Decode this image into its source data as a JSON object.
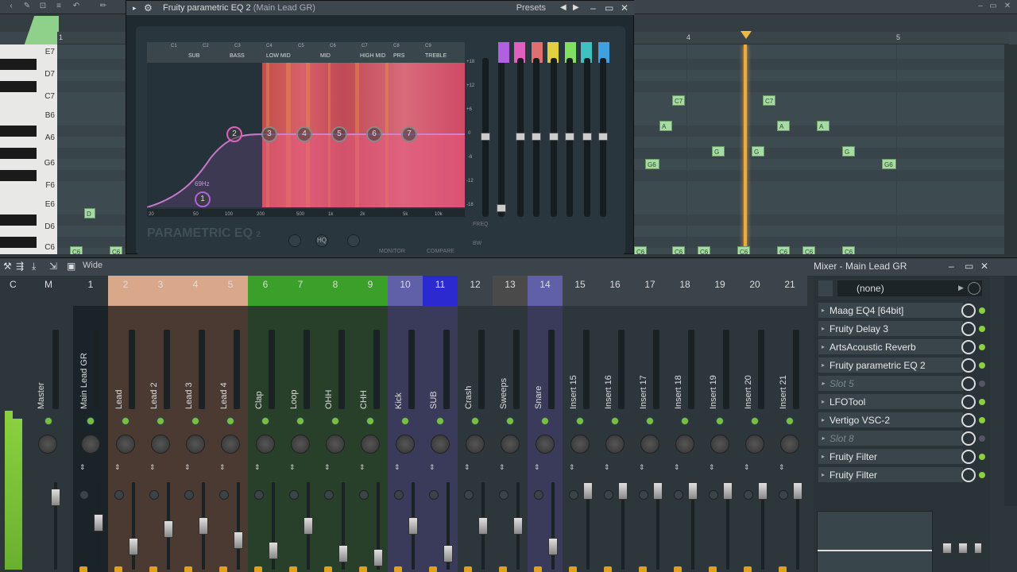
{
  "piano_roll": {
    "ruler": [
      "1",
      "4",
      "5"
    ],
    "keys": [
      "E7",
      "D7",
      "C7",
      "B6",
      "A6",
      "G6",
      "F6",
      "E6",
      "D6",
      "C6"
    ],
    "notes": [
      "D",
      "C7",
      "C7",
      "A",
      "A",
      "A",
      "G",
      "G",
      "G",
      "G6",
      "G6"
    ],
    "bottom_notes": [
      "C6",
      "C6",
      "C6",
      "C6",
      "C6",
      "C6",
      "C6",
      "C6",
      "C6"
    ]
  },
  "eq": {
    "title": "Fruity parametric EQ 2",
    "title_suffix": "(Main Lead GR)",
    "presets_label": "Presets",
    "band_labels": [
      "C1",
      "C2",
      "C3",
      "C4",
      "C5",
      "C6",
      "C7",
      "C8",
      "C9"
    ],
    "band_categories": [
      "SUB",
      "BASS",
      "LOW MID",
      "MID",
      "HIGH MID",
      "PRS",
      "TREBLE"
    ],
    "node_labels": [
      "1",
      "2",
      "3",
      "4",
      "5",
      "6",
      "7"
    ],
    "node1_freq": "69Hz",
    "freq_axis": [
      "20",
      "50",
      "100",
      "200",
      "500",
      "1k",
      "2k",
      "5k",
      "10k"
    ],
    "db_axis": [
      "+18",
      "+12",
      "+6",
      "0",
      "-6",
      "-12",
      "-18"
    ],
    "logo": "PARAMETRIC EQ",
    "logo_num": "2",
    "hq_label": "HQ",
    "monitor_label": "MONITOR",
    "compare_label": "COMPARE",
    "freq_label": "FREQ",
    "bw_label": "BW",
    "band_colors": [
      "#b060e0",
      "#e060c0",
      "#e07070",
      "#e0d040",
      "#80e060",
      "#40c0c0",
      "#40a0e0"
    ]
  },
  "mixer": {
    "title": "Mixer - Main Lead GR",
    "mode": "Wide",
    "master_cols": [
      "C",
      "M"
    ],
    "strips": [
      {
        "num": "1",
        "name": "Main Lead GR",
        "bg": "#1a2428",
        "hbg": "#2c363b",
        "fader": 0.55
      },
      {
        "num": "2",
        "name": "Lead",
        "bg": "#4a3a32",
        "hbg": "#d9a88a",
        "fader": 0.2
      },
      {
        "num": "3",
        "name": "Lead 2",
        "bg": "#4a3a32",
        "hbg": "#d9a88a",
        "fader": 0.45
      },
      {
        "num": "4",
        "name": "Lead 3",
        "bg": "#4a3a32",
        "hbg": "#d9a88a",
        "fader": 0.5
      },
      {
        "num": "5",
        "name": "Lead 4",
        "bg": "#4a3a32",
        "hbg": "#d9a88a",
        "fader": 0.3
      },
      {
        "num": "6",
        "name": "Clap",
        "bg": "#28402a",
        "hbg": "#3aa02a",
        "fader": 0.15
      },
      {
        "num": "7",
        "name": "Loop",
        "bg": "#28402a",
        "hbg": "#3aa02a",
        "fader": 0.5
      },
      {
        "num": "8",
        "name": "OHH",
        "bg": "#28402a",
        "hbg": "#3aa02a",
        "fader": 0.1
      },
      {
        "num": "9",
        "name": "CHH",
        "bg": "#28402a",
        "hbg": "#3aa02a",
        "fader": 0.05
      },
      {
        "num": "10",
        "name": "Kick",
        "bg": "#3a3a5a",
        "hbg": "#6060a8",
        "fader": 0.5
      },
      {
        "num": "11",
        "name": "SUB",
        "bg": "#3a3a5a",
        "hbg": "#2a2ad0",
        "fader": 0.1
      },
      {
        "num": "12",
        "name": "Crash",
        "bg": "#2c363b",
        "hbg": "#3a444a",
        "fader": 0.5
      },
      {
        "num": "13",
        "name": "Sweeps",
        "bg": "#2c363b",
        "hbg": "#4a4a4a",
        "fader": 0.5
      },
      {
        "num": "14",
        "name": "Snare",
        "bg": "#3a3a5a",
        "hbg": "#6060a8",
        "fader": 0.2
      },
      {
        "num": "15",
        "name": "Insert 15",
        "bg": "#2c363b",
        "hbg": "#3a444a",
        "fader": 1
      },
      {
        "num": "16",
        "name": "Insert 16",
        "bg": "#2c363b",
        "hbg": "#3a444a",
        "fader": 1
      },
      {
        "num": "17",
        "name": "Insert 17",
        "bg": "#2c363b",
        "hbg": "#3a444a",
        "fader": 1
      },
      {
        "num": "18",
        "name": "Insert 18",
        "bg": "#2c363b",
        "hbg": "#3a444a",
        "fader": 1
      },
      {
        "num": "19",
        "name": "Insert 19",
        "bg": "#2c363b",
        "hbg": "#3a444a",
        "fader": 1
      },
      {
        "num": "20",
        "name": "Insert 20",
        "bg": "#2c363b",
        "hbg": "#3a444a",
        "fader": 1
      },
      {
        "num": "21",
        "name": "Insert 21",
        "bg": "#2c363b",
        "hbg": "#3a444a",
        "fader": 1
      }
    ],
    "master_name": "Master"
  },
  "fx": {
    "preset": "(none)",
    "slots": [
      {
        "name": "Maag EQ4 [64bit]",
        "empty": false
      },
      {
        "name": "Fruity Delay 3",
        "empty": false
      },
      {
        "name": "ArtsAcoustic Reverb",
        "empty": false
      },
      {
        "name": "Fruity parametric EQ 2",
        "empty": false
      },
      {
        "name": "Slot 5",
        "empty": true
      },
      {
        "name": "LFOTool",
        "empty": false
      },
      {
        "name": "Vertigo VSC-2",
        "empty": false
      },
      {
        "name": "Slot 8",
        "empty": true
      },
      {
        "name": "Fruity Filter",
        "empty": false
      },
      {
        "name": "Fruity Filter",
        "empty": false
      }
    ]
  }
}
